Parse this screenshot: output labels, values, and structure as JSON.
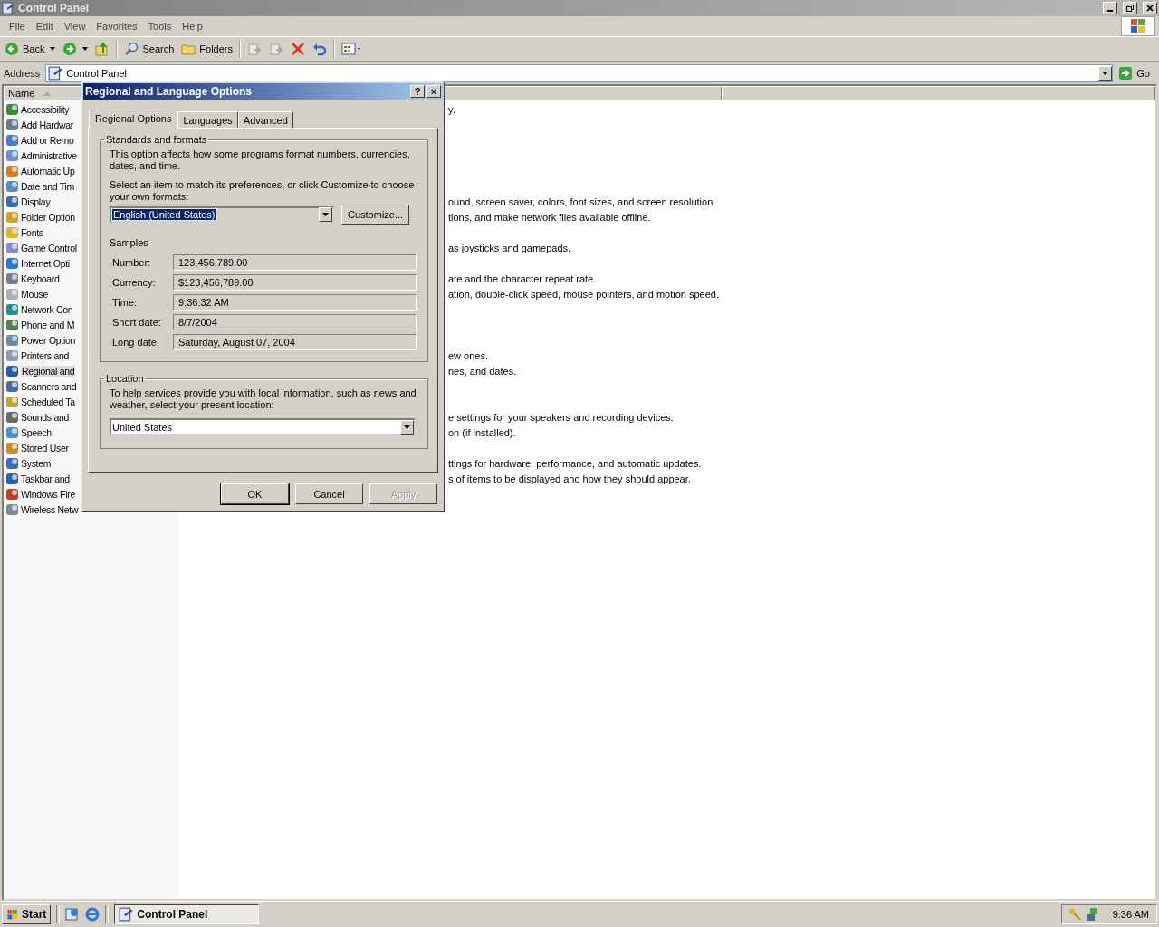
{
  "window": {
    "title": "Control Panel"
  },
  "menu": [
    "File",
    "Edit",
    "View",
    "Favorites",
    "Tools",
    "Help"
  ],
  "toolbar": [
    {
      "kind": "back",
      "label": "Back"
    },
    {
      "kind": "forward"
    },
    {
      "kind": "up"
    },
    {
      "kind": "search",
      "label": "Search"
    },
    {
      "kind": "folders",
      "label": "Folders"
    },
    {
      "kind": "move"
    },
    {
      "kind": "copy"
    },
    {
      "kind": "delete"
    },
    {
      "kind": "undo"
    },
    {
      "kind": "views"
    }
  ],
  "address": {
    "label": "Address",
    "value": "Control Panel",
    "go": "Go"
  },
  "list": {
    "column": "Name",
    "items": [
      {
        "name": "Accessibility",
        "description": "y.",
        "selected": false
      },
      {
        "name": "Add Hardwar",
        "selected": false
      },
      {
        "name": "Add or Remo",
        "selected": false
      },
      {
        "name": "Administrative",
        "selected": false
      },
      {
        "name": "Automatic Up",
        "selected": false
      },
      {
        "name": "Date and Tim",
        "selected": false
      },
      {
        "name": "Display",
        "description": "ound, screen saver, colors, font sizes, and screen resolution.",
        "selected": false
      },
      {
        "name": "Folder Option",
        "description": "tions, and make network files available offline.",
        "selected": false
      },
      {
        "name": "Fonts",
        "selected": false
      },
      {
        "name": "Game Control",
        "description": "as joysticks and gamepads.",
        "selected": false
      },
      {
        "name": "Internet Opti",
        "selected": false
      },
      {
        "name": "Keyboard",
        "description": "ate and the character repeat rate.",
        "selected": false
      },
      {
        "name": "Mouse",
        "description": "ation, double-click speed, mouse pointers, and motion speed.",
        "selected": false
      },
      {
        "name": "Network Con",
        "selected": false
      },
      {
        "name": "Phone and M",
        "selected": false
      },
      {
        "name": "Power Option",
        "selected": false
      },
      {
        "name": "Printers and",
        "description": "ew ones.",
        "selected": false
      },
      {
        "name": "Regional and",
        "description": "nes, and dates.",
        "selected": true
      },
      {
        "name": "Scanners and",
        "selected": false
      },
      {
        "name": "Scheduled Ta",
        "selected": false
      },
      {
        "name": "Sounds and",
        "description": "e settings for your speakers and recording devices.",
        "selected": false
      },
      {
        "name": "Speech",
        "description": "on (if installed).",
        "selected": false
      },
      {
        "name": "Stored User",
        "selected": false
      },
      {
        "name": "System",
        "description": "ttings for hardware, performance, and automatic updates.",
        "selected": false
      },
      {
        "name": "Taskbar and",
        "description": "s of items to be displayed and how they should appear.",
        "selected": false
      },
      {
        "name": "Windows Fire",
        "selected": false
      },
      {
        "name": "Wireless Netw",
        "selected": false
      }
    ]
  },
  "dialog": {
    "title": "Regional and Language Options",
    "help": "?",
    "close": "×",
    "tabs": [
      {
        "label": "Regional Options",
        "selected": true
      },
      {
        "label": "Languages",
        "selected": false
      },
      {
        "label": "Advanced",
        "selected": false
      }
    ],
    "standards": {
      "legend": "Standards and formats",
      "intro": "This option affects how some programs format numbers, currencies, dates, and time.",
      "prompt": "Select an item to match its preferences, or click Customize to choose your own formats:",
      "format": "English (United States)",
      "customize": "Customize...",
      "samples_label": "Samples",
      "samples": [
        {
          "label": "Number:",
          "value": "123,456,789.00"
        },
        {
          "label": "Currency:",
          "value": "$123,456,789.00"
        },
        {
          "label": "Time:",
          "value": "9:36:32 AM"
        },
        {
          "label": "Short date:",
          "value": "8/7/2004"
        },
        {
          "label": "Long date:",
          "value": "Saturday, August 07, 2004"
        }
      ]
    },
    "location": {
      "legend": "Location",
      "text": "To help services provide you with local information, such as news and weather, select your present location:",
      "value": "United States"
    },
    "buttons": [
      {
        "label": "OK",
        "disabled": false
      },
      {
        "label": "Cancel",
        "disabled": false
      },
      {
        "label": "Apply",
        "disabled": true
      }
    ]
  },
  "taskbar": {
    "start": "Start",
    "task": "Control Panel",
    "clock": "9:36 AM"
  }
}
